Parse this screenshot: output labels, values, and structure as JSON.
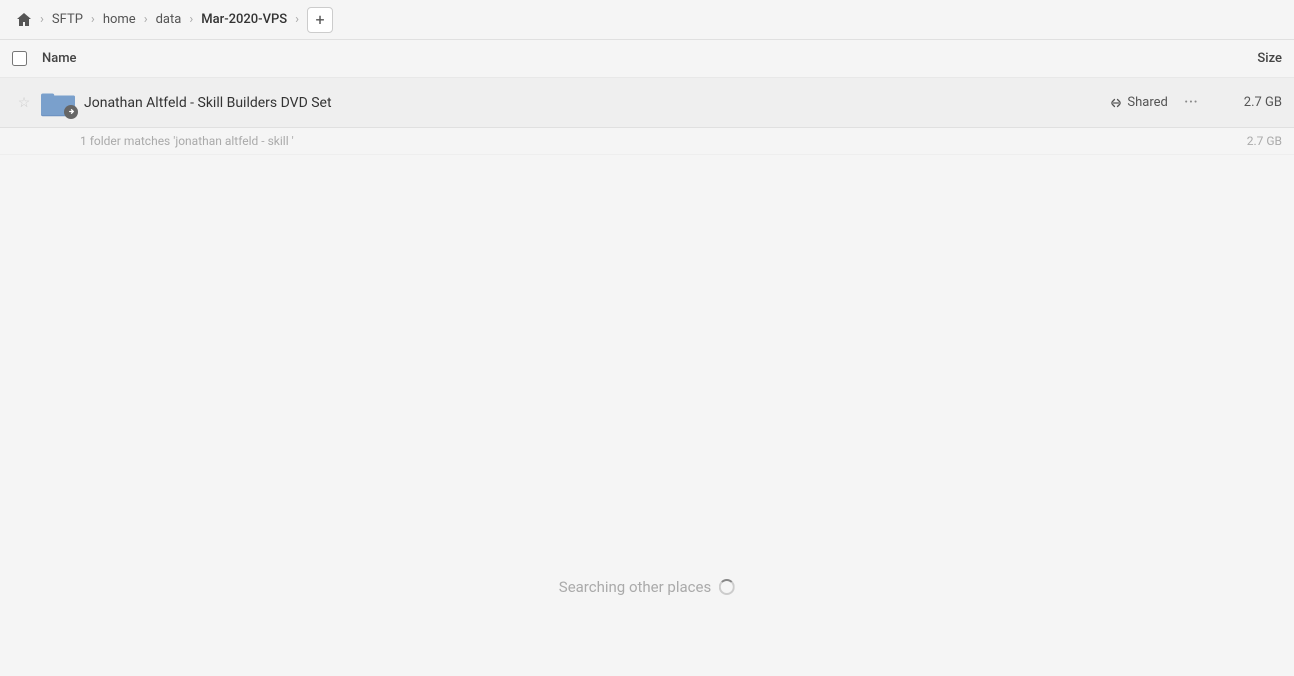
{
  "breadcrumb": {
    "home_label": "home",
    "items": [
      {
        "label": "SFTP",
        "active": false
      },
      {
        "label": "home",
        "active": false
      },
      {
        "label": "data",
        "active": false
      },
      {
        "label": "Mar-2020-VPS",
        "active": true
      }
    ],
    "add_button_label": "+"
  },
  "columns": {
    "name_label": "Name",
    "size_label": "Size"
  },
  "file_row": {
    "name": "Jonathan Altfeld - Skill Builders DVD Set",
    "shared_label": "Shared",
    "size": "2.7 GB",
    "starred": false
  },
  "match_info": {
    "text": "1 folder matches 'jonathan altfeld - skill '",
    "size": "2.7 GB"
  },
  "searching": {
    "label": "Searching other places"
  }
}
